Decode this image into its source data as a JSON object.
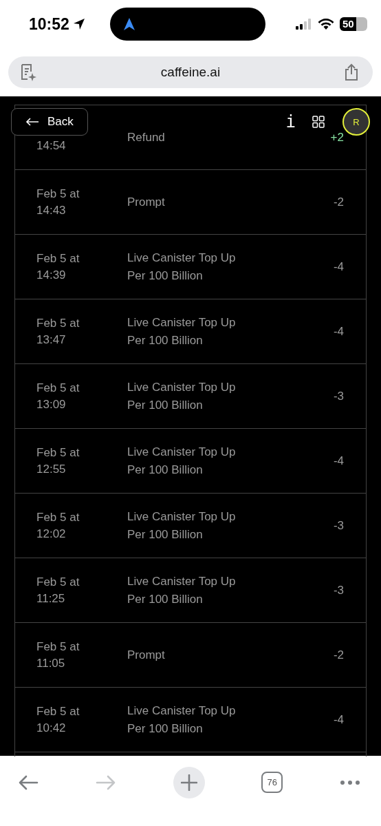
{
  "status_bar": {
    "time": "10:52",
    "battery": "50"
  },
  "browser": {
    "url": "caffeine.ai",
    "tab_count": "76"
  },
  "header": {
    "back": "Back",
    "info": "i",
    "avatar": "R"
  },
  "transactions": [
    {
      "date": [
        "14:54"
      ],
      "description": [
        "Refund"
      ],
      "amount": "+2",
      "kind": "credit"
    },
    {
      "date": [
        "Feb 5 at",
        "14:43"
      ],
      "description": [
        "Prompt"
      ],
      "amount": "-2",
      "kind": "debit"
    },
    {
      "date": [
        "Feb 5 at",
        "14:39"
      ],
      "description": [
        "Live Canister Top Up",
        "Per 100 Billion"
      ],
      "amount": "-4",
      "kind": "debit"
    },
    {
      "date": [
        "Feb 5 at",
        "13:47"
      ],
      "description": [
        "Live Canister Top Up",
        "Per 100 Billion"
      ],
      "amount": "-4",
      "kind": "debit"
    },
    {
      "date": [
        "Feb 5 at",
        "13:09"
      ],
      "description": [
        "Live Canister Top Up",
        "Per 100 Billion"
      ],
      "amount": "-3",
      "kind": "debit"
    },
    {
      "date": [
        "Feb 5 at",
        "12:55"
      ],
      "description": [
        "Live Canister Top Up",
        "Per 100 Billion"
      ],
      "amount": "-4",
      "kind": "debit"
    },
    {
      "date": [
        "Feb 5 at",
        "12:02"
      ],
      "description": [
        "Live Canister Top Up",
        "Per 100 Billion"
      ],
      "amount": "-3",
      "kind": "debit"
    },
    {
      "date": [
        "Feb 5 at",
        "11:25"
      ],
      "description": [
        "Live Canister Top Up",
        "Per 100 Billion"
      ],
      "amount": "-3",
      "kind": "debit"
    },
    {
      "date": [
        "Feb 5 at",
        "11:05"
      ],
      "description": [
        "Prompt"
      ],
      "amount": "-2",
      "kind": "debit"
    },
    {
      "date": [
        "Feb 5 at",
        "10:42"
      ],
      "description": [
        "Live Canister Top Up",
        "Per 100 Billion"
      ],
      "amount": "-4",
      "kind": "debit"
    }
  ]
}
